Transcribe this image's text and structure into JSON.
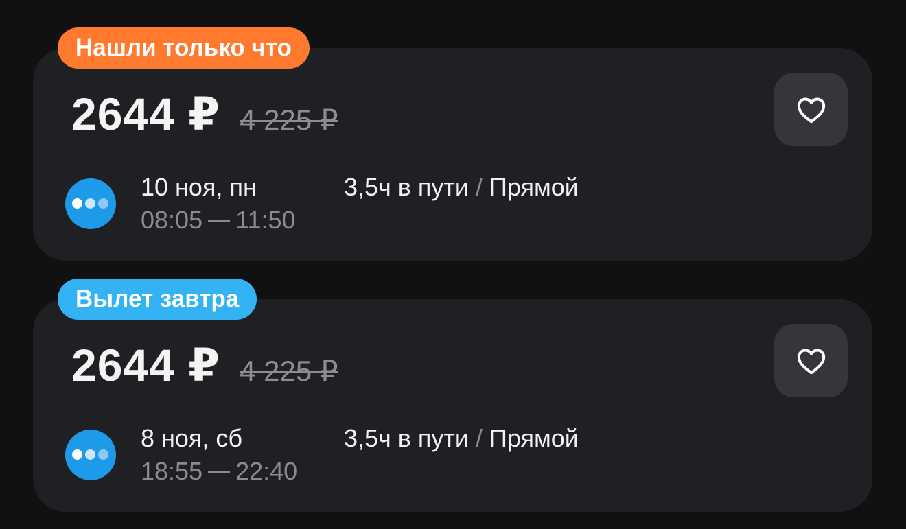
{
  "colors": {
    "background": "#111112",
    "card": "#1f2023",
    "badge_new": "#ff7a2e",
    "badge_tomorrow": "#33b2f4",
    "airline_logo": "#1e9be8"
  },
  "tickets": [
    {
      "badge": "Нашли только что",
      "badge_color": "#ff7a2e",
      "price": "2644 ₽",
      "old_price": "4 225 ₽",
      "favorite_icon": "heart-outline-icon",
      "airline_icon": "three-dots-logo",
      "date": "10 ноя, пн",
      "departure": "08:05",
      "arrival": "11:50",
      "duration": "3,5ч в пути",
      "separator": "/",
      "flight_type": "Прямой"
    },
    {
      "badge": "Вылет завтра",
      "badge_color": "#33b2f4",
      "price": "2644 ₽",
      "old_price": "4 225 ₽",
      "favorite_icon": "heart-outline-icon",
      "airline_icon": "three-dots-logo",
      "date": "8 ноя, сб",
      "departure": "18:55",
      "arrival": "22:40",
      "duration": "3,5ч в пути",
      "separator": "/",
      "flight_type": "Прямой"
    }
  ]
}
